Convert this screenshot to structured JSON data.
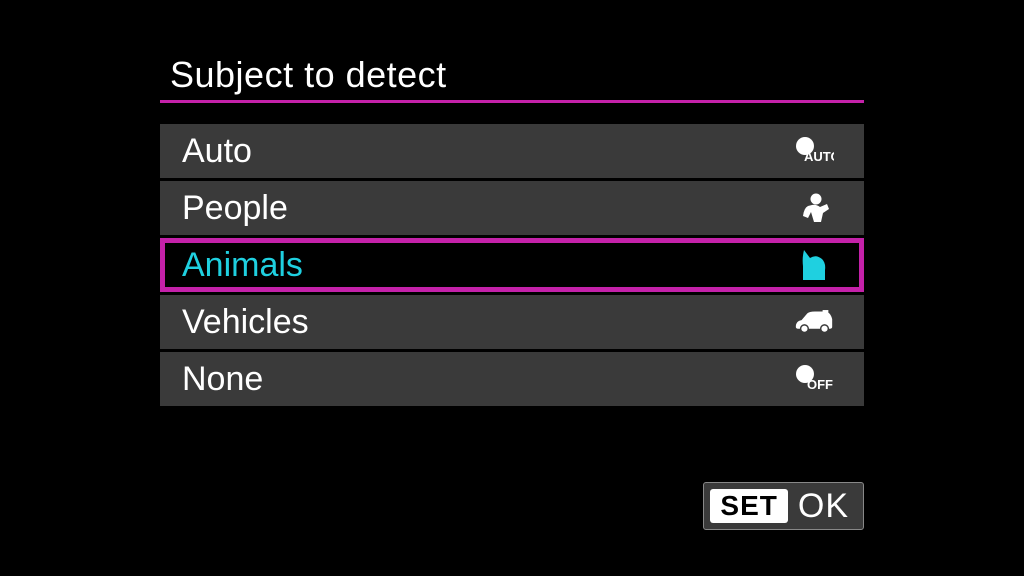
{
  "title": "Subject to detect",
  "menu": {
    "items": [
      {
        "label": "Auto",
        "icon": "auto-icon",
        "selected": false
      },
      {
        "label": "People",
        "icon": "people-icon",
        "selected": false
      },
      {
        "label": "Animals",
        "icon": "animal-icon",
        "selected": true
      },
      {
        "label": "Vehicles",
        "icon": "vehicle-icon",
        "selected": false
      },
      {
        "label": "None",
        "icon": "off-icon",
        "selected": false
      }
    ]
  },
  "footer": {
    "set_label": "SET",
    "ok_label": "OK"
  },
  "icon_text": {
    "auto": "AUTO",
    "off": "OFF"
  },
  "colors": {
    "accent": "#c421a9",
    "selected_text": "#1fd0e0",
    "row_bg": "#3a3a3a"
  }
}
